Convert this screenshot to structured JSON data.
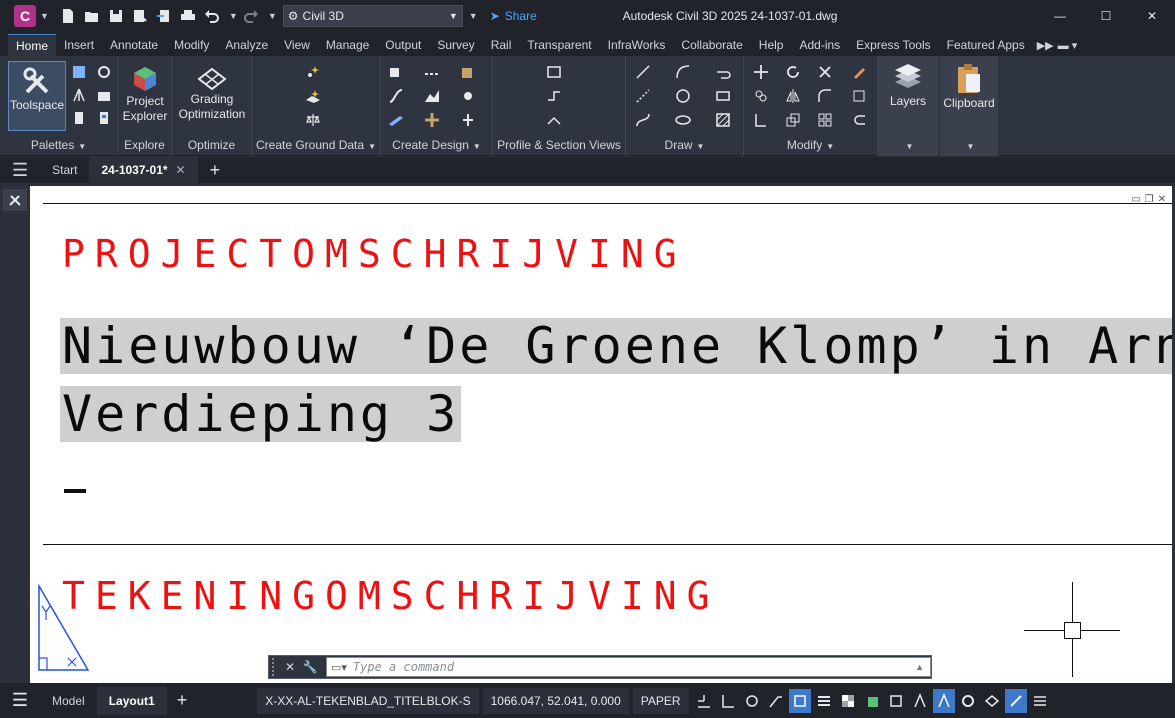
{
  "titlebar": {
    "workspace": "Civil 3D",
    "share": "Share",
    "title": "Autodesk Civil 3D 2025    24-1037-01.dwg",
    "app_letter": "C"
  },
  "tabs": [
    "Home",
    "Insert",
    "Annotate",
    "Modify",
    "Analyze",
    "View",
    "Manage",
    "Output",
    "Survey",
    "Rail",
    "Transparent",
    "InfraWorks",
    "Collaborate",
    "Help",
    "Add-ins",
    "Express Tools",
    "Featured Apps"
  ],
  "ribbon": {
    "palettes": {
      "label": "Palettes",
      "toolspace": "Toolspace"
    },
    "explore": {
      "label": "Explore",
      "project_explorer": "Project Explorer"
    },
    "optimize": {
      "label": "Optimize",
      "grading": "Grading Optimization"
    },
    "ground": {
      "label": "Create Ground Data"
    },
    "design": {
      "label": "Create Design"
    },
    "profile": {
      "label": "Profile & Section Views"
    },
    "draw": {
      "label": "Draw"
    },
    "modify": {
      "label": "Modify"
    },
    "layers": {
      "label": "Layers"
    },
    "clipboard": {
      "label": "Clipboard"
    }
  },
  "filetabs": {
    "start": "Start",
    "active": "24-1037-01*"
  },
  "drawing": {
    "heading1": "PROJECTOMSCHRIJVING",
    "line1": "Nieuwbouw ‘De Groene Klomp’ in Arnhem",
    "line2": "Verdieping 3",
    "heading2": "TEKENINGOMSCHRIJVING"
  },
  "command": {
    "placeholder": "Type a command"
  },
  "status": {
    "model": "Model",
    "layout": "Layout1",
    "layer": "X-XX-AL-TEKENBLAD_TITELBLOK-S",
    "coords": "1066.047, 52.041, 0.000",
    "space": "PAPER"
  },
  "colors": {
    "accent": "#3d79c8",
    "heading": "#ee1111",
    "highlight": "#cfcfcf"
  }
}
